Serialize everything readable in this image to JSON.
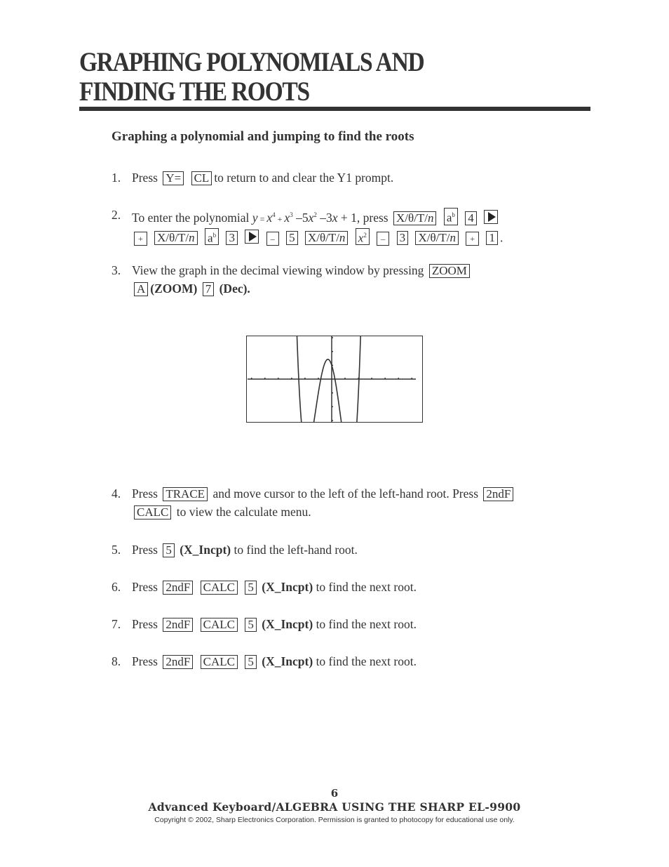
{
  "page": {
    "title_line1": "GRAPHING POLYNOMIALS AND",
    "title_line2": "FINDING THE ROOTS",
    "subtitle": "Graphing a polynomial and jumping to find the roots"
  },
  "steps": {
    "s1": {
      "num": "1.",
      "t1": "Press",
      "k1": "Y=",
      "k2": "CL",
      "t2": "to return to and clear the Y1 prompt."
    },
    "s2": {
      "num": "2.",
      "t1": "To enter the polynomial",
      "eq_y": "y",
      "eq_eq": " = ",
      "eq_x": "x",
      "eq_p4": "4",
      "eq_plus": " + ",
      "eq_p3": "3",
      "eq_m5": " –5",
      "eq_p2": "2",
      "eq_m3": " –3",
      "eq_p1": " + 1, press",
      "keys_row1": [
        "X/θ/T/n",
        "ab",
        "4",
        "►"
      ],
      "keys_row2": [
        "+",
        "X/θ/T/n",
        "ab",
        "3",
        "►",
        "–",
        "5",
        "X/θ/T/n",
        "x2",
        "–",
        "3",
        "X/θ/T/n",
        "+",
        "1"
      ],
      "k_xt": "X/θ/T/",
      "k_n": "n",
      "k_a": "a",
      "k_b": "b",
      "k_4": "4",
      "k_plus": "+",
      "k_3": "3",
      "k_minus": "–",
      "k_5": "5",
      "k_x": "x",
      "k_2": "2",
      "k_1": "1",
      "end": "."
    },
    "s3": {
      "num": "3.",
      "t1": "View the graph in the decimal viewing window by pressing",
      "k1": "ZOOM",
      "k2": "A",
      "b1": "(ZOOM)",
      "k3": "7",
      "b2": "(Dec)."
    },
    "s4": {
      "num": "4.",
      "t1": "Press",
      "k1": "TRACE",
      "t2": "and move cursor to the left of the left-hand root.  Press",
      "k2": "2ndF",
      "k3": "CALC",
      "t3": "to view the calculate menu."
    },
    "s5": {
      "num": "5.",
      "t1": "Press",
      "k1": "5",
      "b1": "(X_Incpt)",
      "t2": "to find the left-hand root."
    },
    "s6": {
      "num": "6.",
      "t1": "Press",
      "k1": "2ndF",
      "k2": "CALC",
      "k3": "5",
      "b1": "(X_Incpt)",
      "t2": "to find the next root."
    },
    "s7": {
      "num": "7.",
      "t1": "Press",
      "k1": "2ndF",
      "k2": "CALC",
      "k3": "5",
      "b1": "(X_Incpt)",
      "t2": "to find the next root."
    },
    "s8": {
      "num": "8.",
      "t1": "Press",
      "k1": "2ndF",
      "k2": "CALC",
      "k3": "5",
      "b1": "(X_Incpt)",
      "t2": "to find the next root."
    }
  },
  "chart_data": {
    "type": "line",
    "title": "",
    "function": "y = x^4 + x^3 - 5x^2 - 3x + 1",
    "coefficients": [
      1,
      1,
      -5,
      -3,
      1
    ],
    "xlim": [
      -6.3,
      6.3
    ],
    "ylim": [
      -3.1,
      3.1
    ],
    "xtick_step": 1,
    "ytick_step": 1,
    "grid": false,
    "roots_approx": [
      -2.43,
      -0.8,
      0.24,
      2.04
    ]
  },
  "footer": {
    "page_number": "6",
    "book_title": "Advanced Keyboard/ALGEBRA USING THE SHARP EL-9900",
    "copyright": "Copyright © 2002, Sharp Electronics Corporation.  Permission is granted to photocopy for educational use only."
  }
}
